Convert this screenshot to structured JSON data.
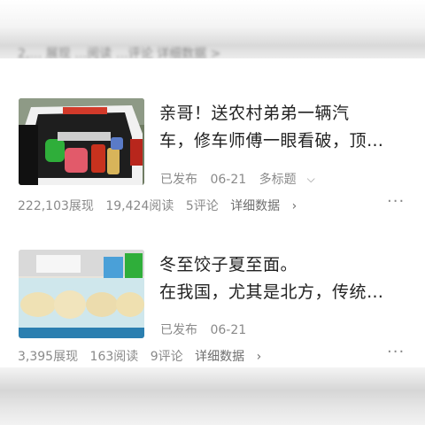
{
  "top_partial_stats": "2,… 展现  …阅读  …评论  详细数据 >",
  "articles": [
    {
      "title_line1": "亲哥！送农村弟弟一辆汽",
      "title_line2": "车，修车师傅一眼看破，顶…",
      "status": "已发布",
      "date": "06-21",
      "extra": "多标题",
      "impressions": "222,103展现",
      "reads": "19,424阅读",
      "comments": "5评论",
      "detail": "详细数据",
      "more": "···"
    },
    {
      "title_line1": "冬至饺子夏至面。",
      "title_line2": "在我国，尤其是北方，传统…",
      "status": "已发布",
      "date": "06-21",
      "impressions": "3,395展现",
      "reads": "163阅读",
      "comments": "9评论",
      "detail": "详细数据",
      "more": "···"
    }
  ],
  "icons": {
    "dropdown": "chevron-down-icon",
    "detail_arrow": "chevron-right-icon"
  },
  "colors": {
    "title": "#222222",
    "meta": "#8a8a8a"
  }
}
